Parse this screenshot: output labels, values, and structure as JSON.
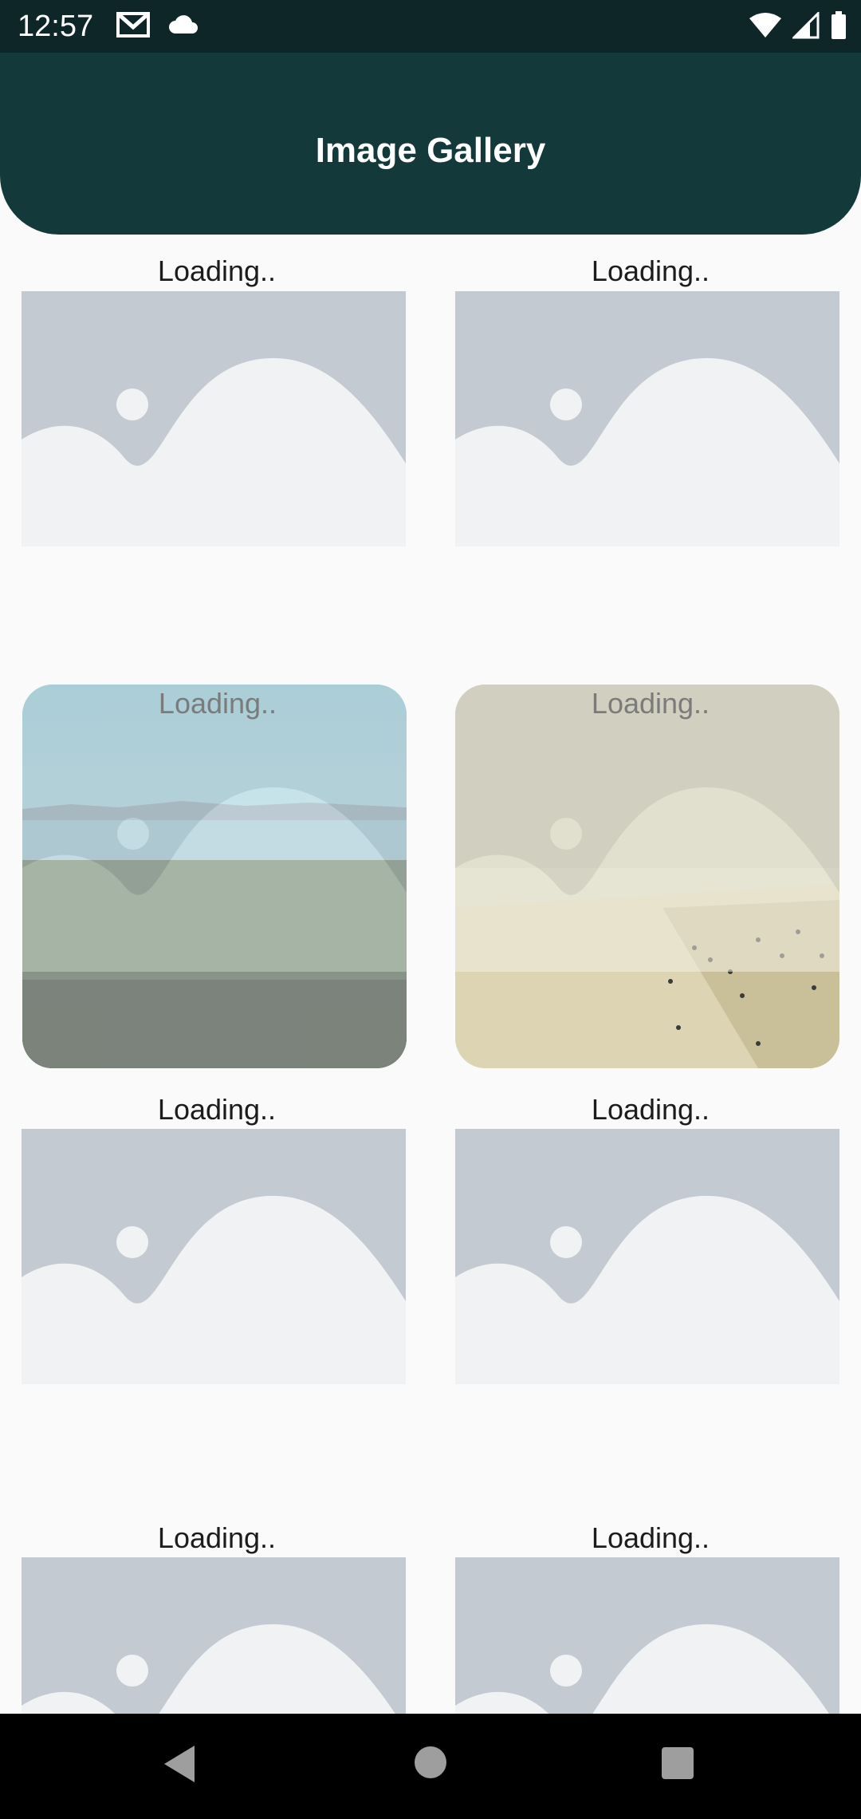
{
  "status_bar": {
    "time": "12:57",
    "left_icons": [
      "gmail-icon",
      "cloud-icon"
    ],
    "right_icons": [
      "wifi-icon",
      "signal-icon",
      "battery-icon"
    ]
  },
  "app_bar": {
    "title": "Image Gallery",
    "color": "#14393b"
  },
  "gallery": {
    "placeholder_color": "#c3cad2",
    "tiles": [
      {
        "caption": "Loading..",
        "state": "placeholder"
      },
      {
        "caption": "Loading..",
        "state": "placeholder"
      },
      {
        "caption": "Loading..",
        "state": "loading-photo",
        "photo": "forest-sea-photo"
      },
      {
        "caption": "Loading..",
        "state": "loading-photo",
        "photo": "beach-crowd-photo"
      },
      {
        "caption": "Loading..",
        "state": "placeholder"
      },
      {
        "caption": "Loading..",
        "state": "placeholder"
      },
      {
        "caption": "Loading..",
        "state": "placeholder"
      },
      {
        "caption": "Loading..",
        "state": "placeholder"
      }
    ]
  },
  "nav_bar": {
    "buttons": [
      "back-icon",
      "home-icon",
      "recents-icon"
    ]
  }
}
